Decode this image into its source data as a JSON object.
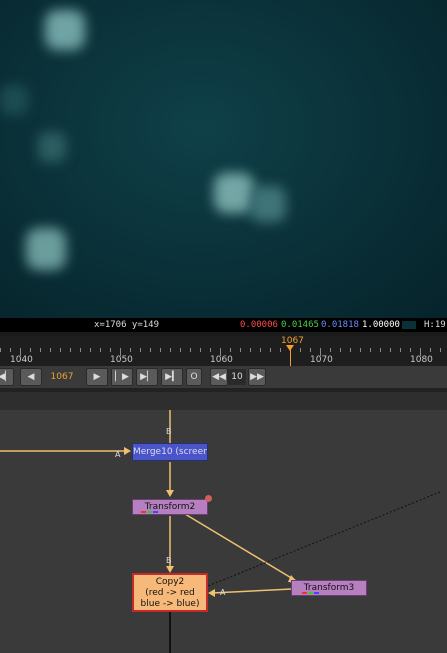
{
  "viewer": {
    "coords": "x=1706 y=149",
    "red": "0.00006",
    "green": "0.01465",
    "blue": "0.01818",
    "alpha": "1.00000",
    "hsv_prefix": "H:19",
    "colors": {
      "red": "#ff4b4b",
      "green": "#4cd24c",
      "blue": "#6a8cff",
      "alpha": "#ffffff"
    }
  },
  "timeline": {
    "current_frame": "1067",
    "tick_labels": [
      "1040",
      "1050",
      "1060",
      "1070",
      "1080"
    ],
    "cursor_color": "#f0a030"
  },
  "transport": {
    "frame_field": "1067",
    "step_value": "10",
    "first_icon": "skip-to-start-icon",
    "prev_icon": "step-back-icon",
    "play_icon": "play-icon",
    "next_keyframe_icon": "next-keyframe-icon",
    "step_forward_icon": "step-forward-icon",
    "last_icon": "skip-to-end-icon",
    "o_label": "O",
    "back_step_icon": "rewind-step-icon",
    "fwd_step_icon": "forward-step-icon"
  },
  "graph": {
    "nodes": {
      "merge": "Merge10 (screen)",
      "transform2": "Transform2",
      "copy2": "Copy2\n(red -> red\nblue -> blue)",
      "transform3": "Transform3"
    },
    "input_labels": {
      "merge_a": "A",
      "merge_b": "B",
      "copy_b": "B",
      "copy_a": "A"
    },
    "colors": {
      "pipe": "#f0c070",
      "merge": "#4a55c9",
      "transform": "#b57fc0",
      "copy": "#f6b979",
      "selected_border": "#c42a2a"
    }
  }
}
